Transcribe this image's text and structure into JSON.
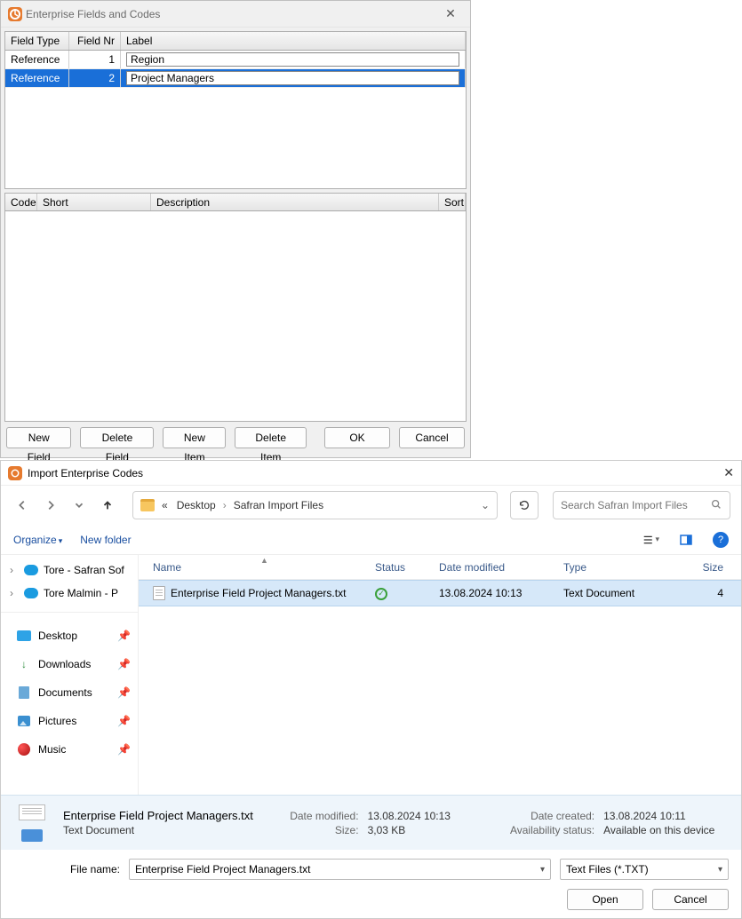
{
  "win1": {
    "title": "Enterprise Fields and Codes",
    "grid1": {
      "headers": {
        "type": "Field Type",
        "nr": "Field Nr",
        "label": "Label"
      },
      "rows": [
        {
          "type": "Reference",
          "nr": "1",
          "label": "Region",
          "selected": false
        },
        {
          "type": "Reference",
          "nr": "2",
          "label": "Project Managers",
          "selected": true
        }
      ]
    },
    "grid2": {
      "headers": {
        "code": "Code",
        "short": "Short",
        "desc": "Description",
        "sort": "Sort"
      }
    },
    "buttons": {
      "new_field": "New Field",
      "delete_field": "Delete Field",
      "new_item": "New Item",
      "delete_item": "Delete Item",
      "ok": "OK",
      "cancel": "Cancel"
    }
  },
  "win2": {
    "title": "Import Enterprise Codes",
    "breadcrumb": {
      "sep0": "«",
      "c1": "Desktop",
      "c2": "Safran Import Files"
    },
    "search_placeholder": "Search Safran Import Files",
    "organize": "Organize",
    "new_folder": "New folder",
    "sidebar": {
      "top": [
        {
          "label": "Tore - Safran Sof"
        },
        {
          "label": "Tore Malmin - P"
        }
      ],
      "quick": [
        {
          "label": "Desktop",
          "ico": "desktop"
        },
        {
          "label": "Downloads",
          "ico": "down"
        },
        {
          "label": "Documents",
          "ico": "doc"
        },
        {
          "label": "Pictures",
          "ico": "pic"
        },
        {
          "label": "Music",
          "ico": "music"
        }
      ]
    },
    "file_headers": {
      "name": "Name",
      "status": "Status",
      "mod": "Date modified",
      "type": "Type",
      "size": "Size"
    },
    "file_row": {
      "name": "Enterprise Field Project Managers.txt",
      "mod": "13.08.2024 10:13",
      "type": "Text Document",
      "size": "4"
    },
    "details": {
      "fname": "Enterprise Field Project Managers.txt",
      "ftype": "Text Document",
      "mod_label": "Date modified:",
      "mod_val": "13.08.2024 10:13",
      "size_label": "Size:",
      "size_val": "3,03 KB",
      "created_label": "Date created:",
      "created_val": "13.08.2024 10:11",
      "avail_label": "Availability status:",
      "avail_val": "Available on this device"
    },
    "filename_label": "File name:",
    "filename_value": "Enterprise Field Project Managers.txt",
    "filter_value": "Text Files (*.TXT)",
    "open": "Open",
    "cancel": "Cancel"
  }
}
